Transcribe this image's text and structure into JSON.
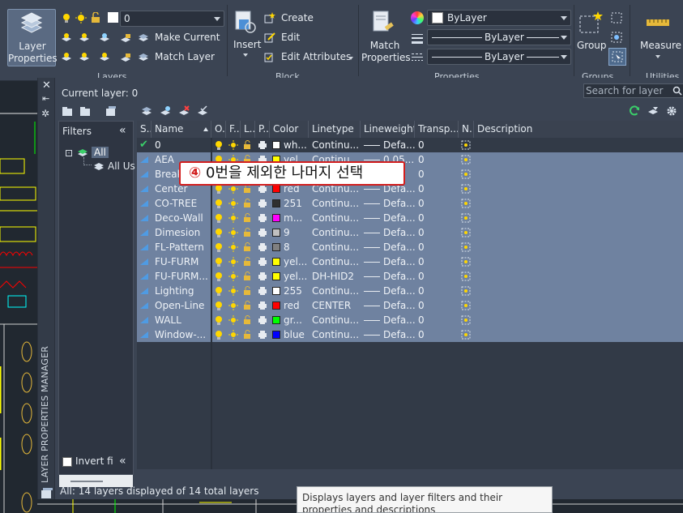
{
  "ribbon": {
    "layer_properties": "Layer\nProperties",
    "layers_panel_label": "Layers",
    "current_layer_value": "0",
    "make_current": "Make Current",
    "match_layer": "Match Layer",
    "insert": "Insert",
    "create": "Create",
    "edit": "Edit",
    "edit_attributes": "Edit Attributes",
    "block_panel_label": "Block",
    "match_properties": "Match\nProperties",
    "color_value": "ByLayer",
    "lineweight_value": "ByLayer",
    "linetype_value": "ByLayer",
    "properties_panel_label": "Properties",
    "group": "Group",
    "groups_panel_label": "Groups",
    "measure": "Measure",
    "utilities_panel_label": "Utilities"
  },
  "palette": {
    "title": "LAYER PROPERTIES MANAGER",
    "current_layer": "Current layer: 0",
    "search_placeholder": "Search for layer",
    "filters_label": "Filters",
    "tree_all": "All",
    "tree_all_used": "All Us",
    "invert_filter": "Invert fi",
    "status": "All: 14 layers displayed of 14 total layers"
  },
  "columns": [
    "S..",
    "Name",
    "O..",
    "F..",
    "L..",
    "P..",
    "Color",
    "Linetype",
    "Lineweight",
    "Transp...",
    "N..",
    "Description"
  ],
  "layers": [
    {
      "name": "0",
      "color_name": "wh...",
      "color_hex": "#ffffff",
      "linetype": "Continu...",
      "lineweight": "Defa...",
      "transparency": "0",
      "current": true,
      "selected": false
    },
    {
      "name": "AEA",
      "color_name": "yel...",
      "color_hex": "#ffff00",
      "linetype": "Continu...",
      "lineweight": "0.05...",
      "transparency": "0",
      "current": false,
      "selected": true
    },
    {
      "name": "Break",
      "color_name": "",
      "color_hex": "#ffffff",
      "linetype": "",
      "lineweight": "",
      "transparency": "0",
      "current": false,
      "selected": true
    },
    {
      "name": "Center",
      "color_name": "red",
      "color_hex": "#ff0000",
      "linetype": "Continu...",
      "lineweight": "Defa...",
      "transparency": "0",
      "current": false,
      "selected": true
    },
    {
      "name": "CO-TREE",
      "color_name": "251",
      "color_hex": "#2f2f2f",
      "linetype": "Continu...",
      "lineweight": "Defa...",
      "transparency": "0",
      "current": false,
      "selected": true
    },
    {
      "name": "Deco-Wall",
      "color_name": "m...",
      "color_hex": "#ff00ff",
      "linetype": "Continu...",
      "lineweight": "Defa...",
      "transparency": "0",
      "current": false,
      "selected": true
    },
    {
      "name": "Dimesion",
      "color_name": "9",
      "color_hex": "#c0c0c0",
      "linetype": "Continu...",
      "lineweight": "Defa...",
      "transparency": "0",
      "current": false,
      "selected": true
    },
    {
      "name": "FL-Pattern",
      "color_name": "8",
      "color_hex": "#808080",
      "linetype": "Continu...",
      "lineweight": "Defa...",
      "transparency": "0",
      "current": false,
      "selected": true
    },
    {
      "name": "FU-FURM",
      "color_name": "yel...",
      "color_hex": "#ffff00",
      "linetype": "Continu...",
      "lineweight": "Defa...",
      "transparency": "0",
      "current": false,
      "selected": true
    },
    {
      "name": "FU-FURM...",
      "color_name": "yel...",
      "color_hex": "#ffff00",
      "linetype": "DH-HID2",
      "lineweight": "Defa...",
      "transparency": "0",
      "current": false,
      "selected": true
    },
    {
      "name": "Lighting",
      "color_name": "255",
      "color_hex": "#ffffff",
      "linetype": "Continu...",
      "lineweight": "Defa...",
      "transparency": "0",
      "current": false,
      "selected": true
    },
    {
      "name": "Open-Line",
      "color_name": "red",
      "color_hex": "#ff0000",
      "linetype": "CENTER",
      "lineweight": "Defa...",
      "transparency": "0",
      "current": false,
      "selected": true
    },
    {
      "name": "WALL",
      "color_name": "gr...",
      "color_hex": "#00ff00",
      "linetype": "Continu...",
      "lineweight": "Defa...",
      "transparency": "0",
      "current": false,
      "selected": true
    },
    {
      "name": "Window-...",
      "color_name": "blue",
      "color_hex": "#0000ff",
      "linetype": "Continu...",
      "lineweight": "Defa...",
      "transparency": "0",
      "current": false,
      "selected": true
    }
  ],
  "annotation": {
    "number": "④",
    "text": " 0번을 제외한 나머지 선택"
  },
  "tooltip": "Displays layers and layer filters and their properties and descriptions"
}
